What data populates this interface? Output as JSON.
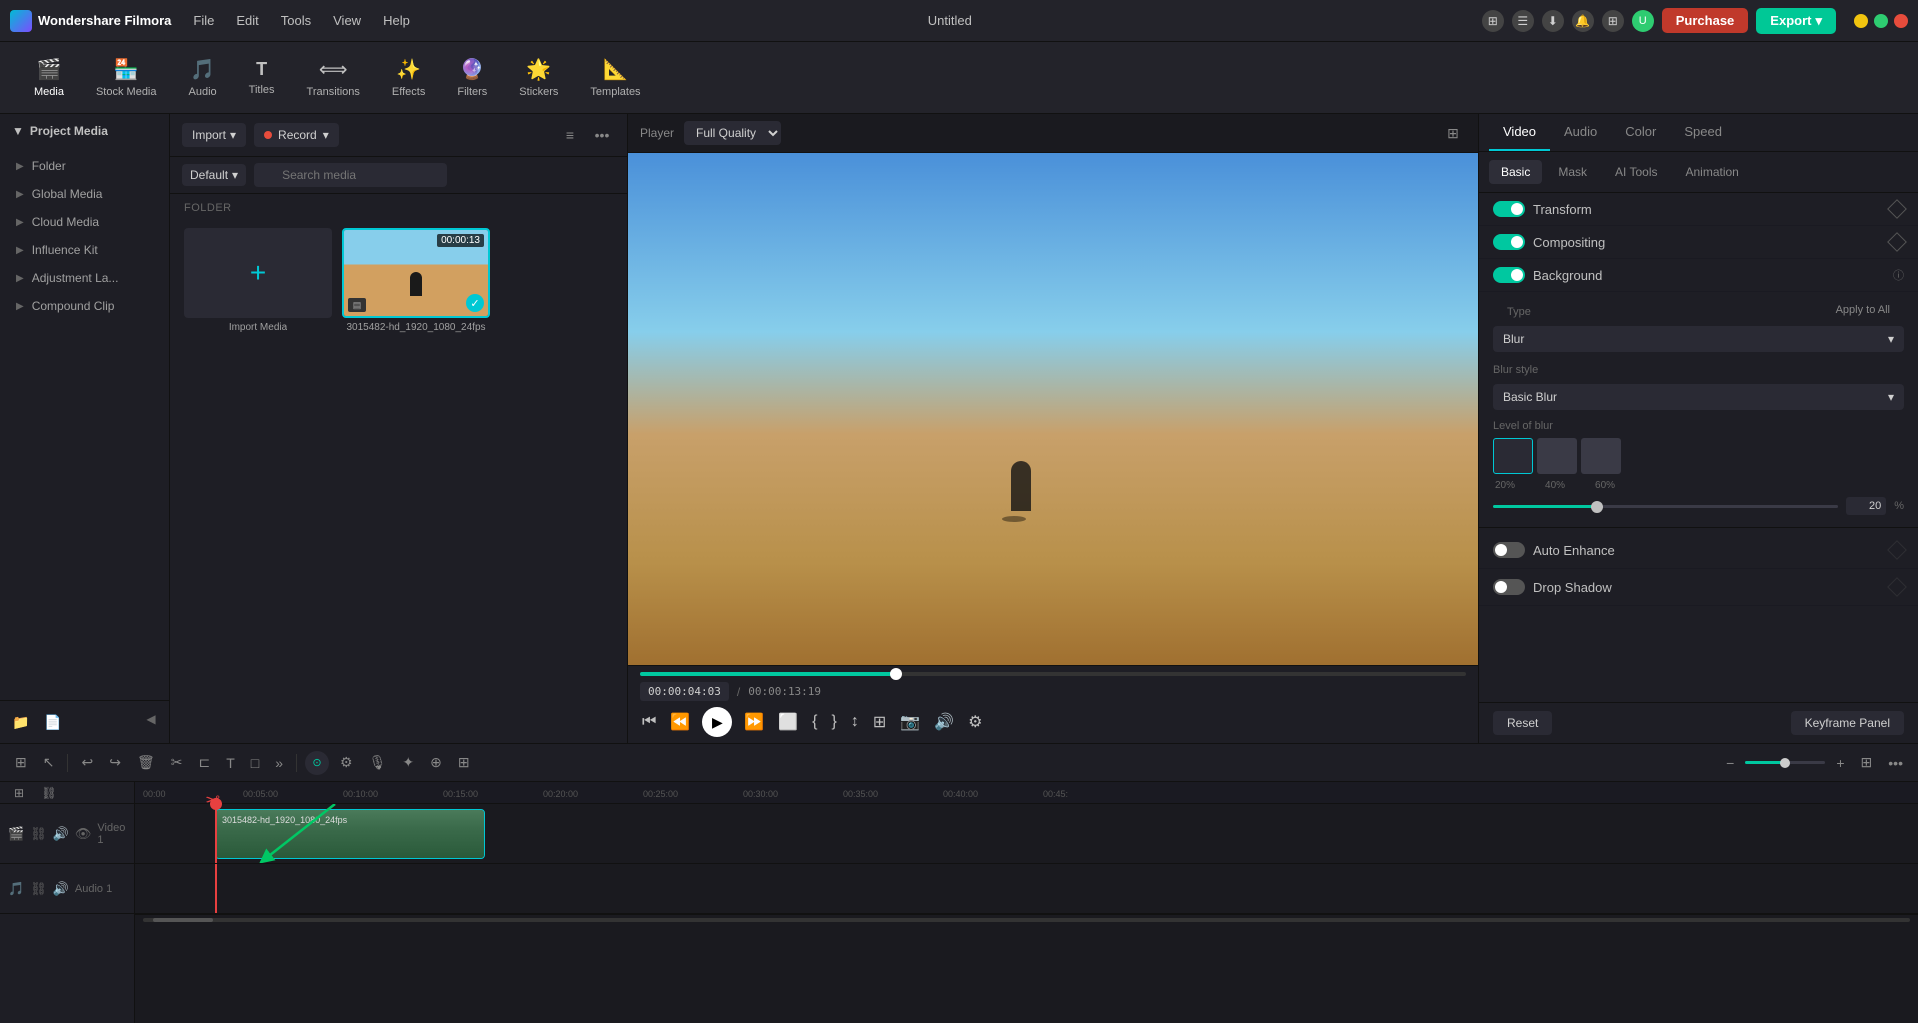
{
  "app": {
    "name": "Wondershare Filmora",
    "title": "Untitled",
    "logo_text": "Wondershare Filmora"
  },
  "menu": {
    "items": [
      "File",
      "Edit",
      "Tools",
      "View",
      "Help"
    ]
  },
  "topbar": {
    "purchase_label": "Purchase",
    "export_label": "Export"
  },
  "toolbar": {
    "items": [
      {
        "id": "media",
        "icon": "🎬",
        "label": "Media",
        "active": true
      },
      {
        "id": "stock-media",
        "icon": "🏪",
        "label": "Stock Media",
        "active": false
      },
      {
        "id": "audio",
        "icon": "🎵",
        "label": "Audio",
        "active": false
      },
      {
        "id": "titles",
        "icon": "T",
        "label": "Titles",
        "active": false
      },
      {
        "id": "transitions",
        "icon": "⟺",
        "label": "Transitions",
        "active": false
      },
      {
        "id": "effects",
        "icon": "✨",
        "label": "Effects",
        "active": false
      },
      {
        "id": "filters",
        "icon": "🔮",
        "label": "Filters",
        "active": false
      },
      {
        "id": "stickers",
        "icon": "🌟",
        "label": "Stickers",
        "active": false
      },
      {
        "id": "templates",
        "icon": "📐",
        "label": "Templates",
        "active": false
      }
    ]
  },
  "left_panel": {
    "header": "Project Media",
    "items": [
      {
        "label": "Folder"
      },
      {
        "label": "Global Media"
      },
      {
        "label": "Cloud Media"
      },
      {
        "label": "Influence Kit"
      },
      {
        "label": "Adjustment La..."
      },
      {
        "label": "Compound Clip"
      }
    ]
  },
  "media_panel": {
    "import_label": "Import",
    "record_label": "Record",
    "default_label": "Default",
    "search_placeholder": "Search media",
    "folder_label": "FOLDER",
    "import_media_label": "Import Media",
    "media_item_label": "3015482-hd_1920_1080_24fps",
    "media_duration": "00:00:13"
  },
  "preview": {
    "player_label": "Player",
    "quality_label": "Full Quality",
    "current_time": "00:00:04:03",
    "total_time": "00:00:13:19",
    "progress_pct": 31
  },
  "right_panel": {
    "tabs": [
      "Video",
      "Audio",
      "Color",
      "Speed"
    ],
    "active_tab": "Video",
    "subtabs": [
      "Basic",
      "Mask",
      "AI Tools",
      "Animation"
    ],
    "active_subtab": "Basic",
    "properties": [
      {
        "label": "Transform",
        "enabled": true
      },
      {
        "label": "Compositing",
        "enabled": true
      },
      {
        "label": "Background",
        "enabled": true,
        "has_info": true
      }
    ],
    "type_label": "Type",
    "type_value": "Blur",
    "apply_to_all_label": "Apply to All",
    "blur_style_label": "Blur style",
    "blur_style_value": "Basic Blur",
    "blur_level_label": "Level of blur",
    "blur_pct_labels": [
      "20%",
      "40%",
      "60%"
    ],
    "blur_value": 20,
    "blur_pct_symbol": "%",
    "auto_enhance_label": "Auto Enhance",
    "drop_shadow_label": "Drop Shadow",
    "reset_label": "Reset",
    "keyframe_label": "Keyframe Panel"
  },
  "timeline": {
    "ruler_times": [
      "00:00",
      "00:05:00",
      "00:10:00",
      "00:15:00",
      "00:20:00",
      "00:25:00",
      "00:30:00",
      "00:35:00",
      "00:40:00",
      "00:45:"
    ],
    "track_label_video": "Video 1",
    "track_label_audio": "Audio 1",
    "clip_label": "3015482-hd_1920_1080_24fps",
    "playhead_pos_pct": 11
  }
}
